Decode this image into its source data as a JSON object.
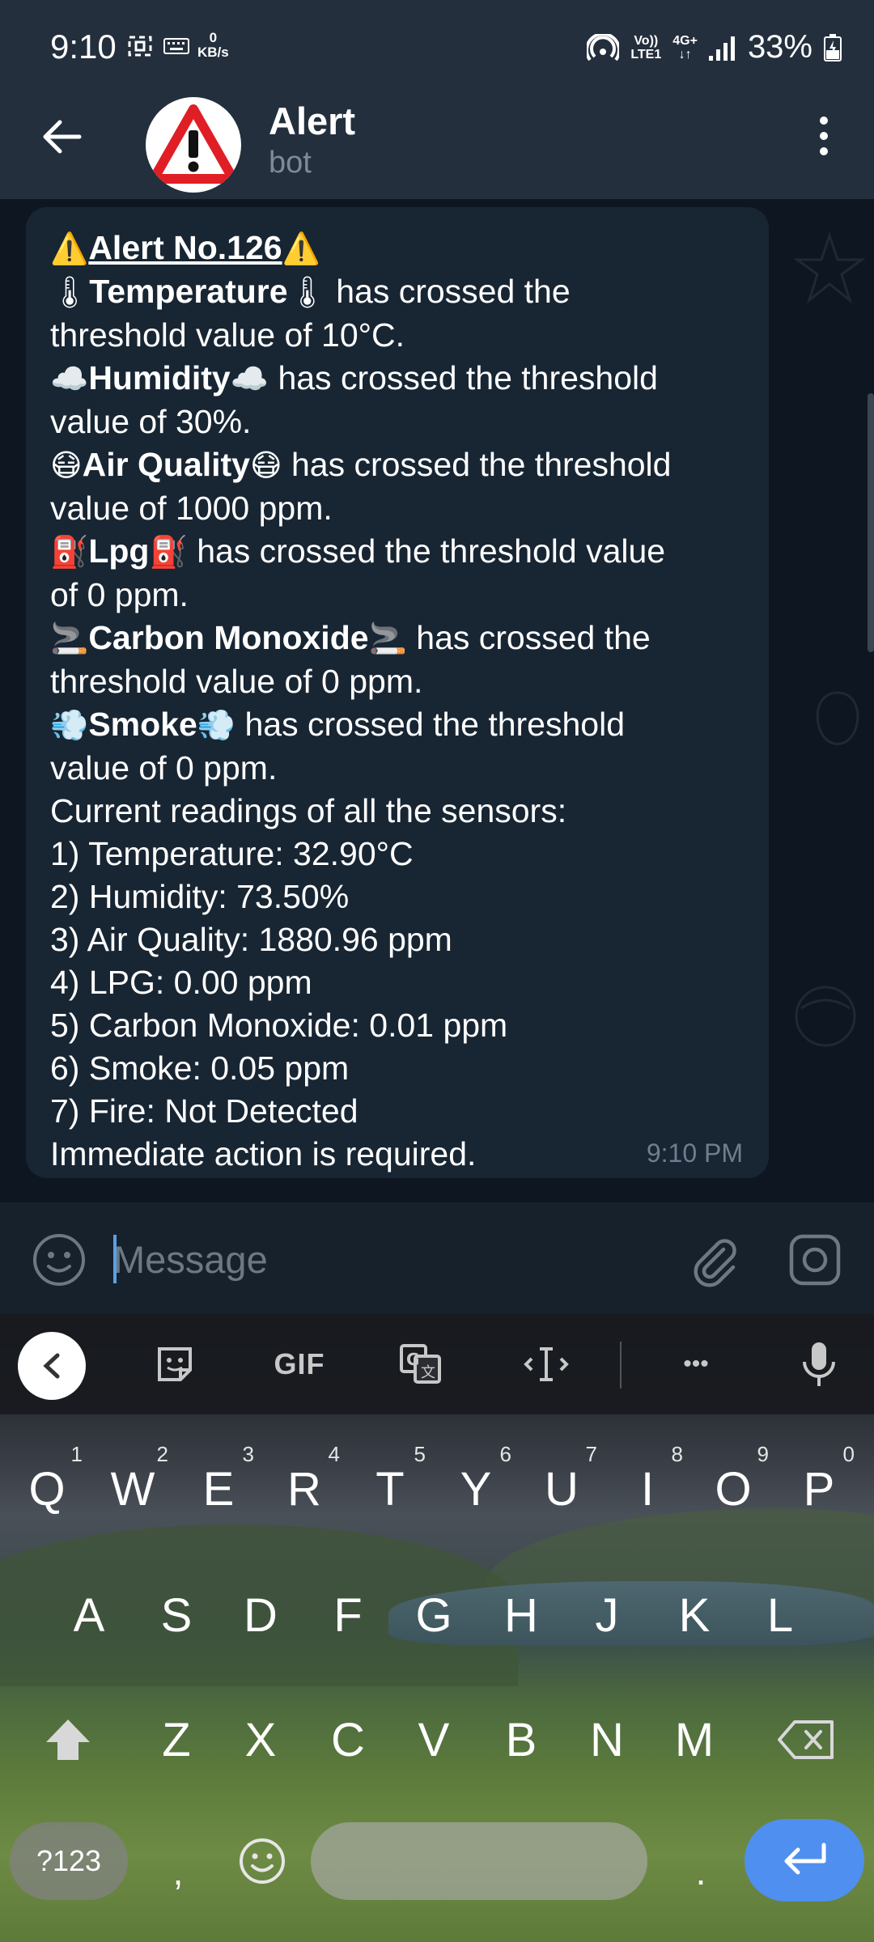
{
  "status_bar": {
    "time": "9:10",
    "net_speed_value": "0",
    "net_speed_unit": "KB/s",
    "volte": "Vo))",
    "lte": "LTE1",
    "network": "4G+",
    "battery": "33%"
  },
  "header": {
    "title": "Alert",
    "subtitle": "bot"
  },
  "message": {
    "alert_title": "Alert No.126",
    "lines": {
      "temp_name": "Temperature",
      "temp_text_1": " has crossed the",
      "temp_text_2": "threshold value of 10°C.",
      "hum_name": "Humidity",
      "hum_text_1": " has crossed the threshold",
      "hum_text_2": "value of 30%.",
      "air_name": "Air Quality",
      "air_text_1": " has crossed the threshold",
      "air_text_2": "value of 1000 ppm.",
      "lpg_name": "Lpg",
      "lpg_text_1": " has crossed the threshold value",
      "lpg_text_2": "of 0 ppm.",
      "co_name": "Carbon Monoxide",
      "co_text_1": " has crossed the",
      "co_text_2": "threshold value of 0 ppm.",
      "smoke_name": "Smoke",
      "smoke_text_1": " has crossed the threshold",
      "smoke_text_2": "value of 0 ppm.",
      "readings_header": "Current readings of all the sensors:",
      "reading_1": "1) Temperature: 32.90°C",
      "reading_2": "2) Humidity: 73.50%",
      "reading_3": "3) Air Quality: 1880.96 ppm",
      "reading_4": "4) LPG: 0.00 ppm",
      "reading_5": "5) Carbon Monoxide: 0.01 ppm",
      "reading_6": "6) Smoke: 0.05 ppm",
      "reading_7": "7) Fire: Not Detected",
      "footer": "Immediate action is required."
    },
    "time": "9:10 PM"
  },
  "input": {
    "placeholder": "Message"
  },
  "keyboard": {
    "toolbar": {
      "gif_label": "GIF",
      "more_label": "•••"
    },
    "row1": [
      {
        "key": "Q",
        "hint": "1"
      },
      {
        "key": "W",
        "hint": "2"
      },
      {
        "key": "E",
        "hint": "3"
      },
      {
        "key": "R",
        "hint": "4"
      },
      {
        "key": "T",
        "hint": "5"
      },
      {
        "key": "Y",
        "hint": "6"
      },
      {
        "key": "U",
        "hint": "7"
      },
      {
        "key": "I",
        "hint": "8"
      },
      {
        "key": "O",
        "hint": "9"
      },
      {
        "key": "P",
        "hint": "0"
      }
    ],
    "row2": [
      "A",
      "S",
      "D",
      "F",
      "G",
      "H",
      "J",
      "K",
      "L"
    ],
    "row3": [
      "Z",
      "X",
      "C",
      "V",
      "B",
      "N",
      "M"
    ],
    "sym_label": "?123",
    "comma": ",",
    "period": "."
  }
}
